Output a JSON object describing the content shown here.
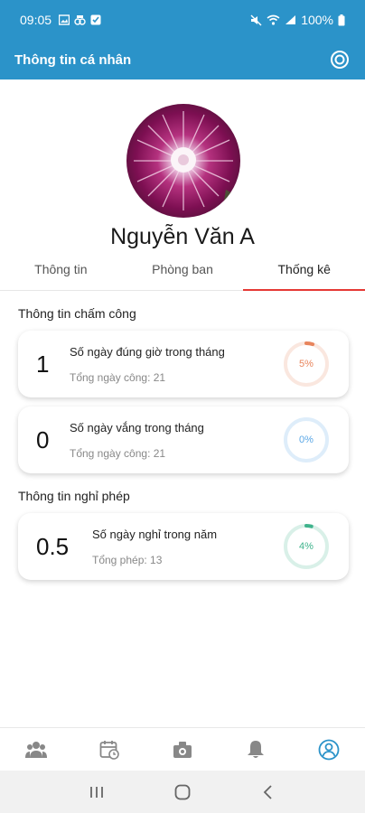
{
  "status_bar": {
    "time": "09:05",
    "battery": "100%"
  },
  "header": {
    "title": "Thông tin cá nhân"
  },
  "profile": {
    "name": "Nguyễn Văn A"
  },
  "tabs": [
    {
      "label": "Thông tin",
      "active": false
    },
    {
      "label": "Phòng ban",
      "active": false
    },
    {
      "label": "Thống kê",
      "active": true
    }
  ],
  "attendance": {
    "title": "Thông tin chấm công",
    "cards": [
      {
        "value": "1",
        "label": "Số ngày đúng giờ trong tháng",
        "sub": "Tổng ngày công: 21",
        "percent_text": "5%",
        "percent": 5,
        "color": "#e8855d"
      },
      {
        "value": "0",
        "label": "Số ngày vắng trong tháng",
        "sub": "Tổng ngày công: 21",
        "percent_text": "0%",
        "percent": 0,
        "color": "#5aa7e6"
      }
    ]
  },
  "leave": {
    "title": "Thông tin nghỉ phép",
    "cards": [
      {
        "value": "0.5",
        "label": "Số ngày nghỉ trong năm",
        "sub": "Tổng phép: 13",
        "percent_text": "4%",
        "percent": 4,
        "color": "#3fb38c"
      }
    ]
  },
  "bottom_nav": [
    {
      "icon": "people-icon"
    },
    {
      "icon": "calendar-icon"
    },
    {
      "icon": "camera-icon"
    },
    {
      "icon": "bell-icon"
    },
    {
      "icon": "profile-icon",
      "active": true
    }
  ],
  "colors": {
    "primary": "#2b93c9",
    "tab_indicator": "#e53935"
  }
}
